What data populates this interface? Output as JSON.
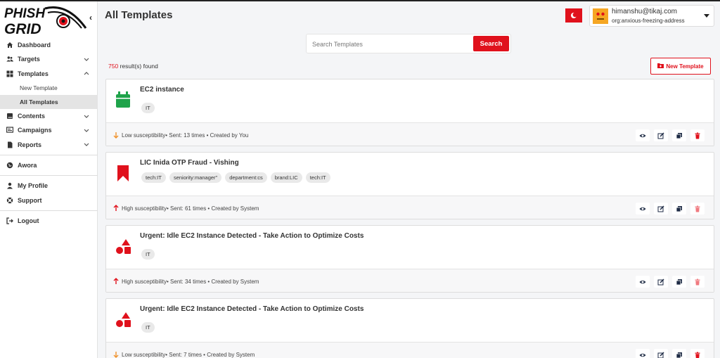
{
  "app": {
    "logo_text": "PHISH GRID",
    "page_title": "All Templates"
  },
  "sidebar": {
    "items": [
      {
        "label": "Dashboard",
        "icon": "home-icon",
        "chevron": false
      },
      {
        "label": "Targets",
        "icon": "users-icon",
        "chevron": "down"
      },
      {
        "label": "Templates",
        "icon": "grid-icon",
        "chevron": "up"
      }
    ],
    "sub_items": [
      {
        "label": "New Template",
        "active": false
      },
      {
        "label": "All Templates",
        "active": true
      }
    ],
    "items2": [
      {
        "label": "Contents",
        "icon": "book-icon",
        "chevron": "down"
      },
      {
        "label": "Campaigns",
        "icon": "campaign-icon",
        "chevron": "down"
      },
      {
        "label": "Reports",
        "icon": "file-icon",
        "chevron": "down"
      }
    ],
    "org": {
      "label": "Awora",
      "icon": "globe-icon"
    },
    "account": [
      {
        "label": "My Profile",
        "icon": "person-icon"
      },
      {
        "label": "Support",
        "icon": "lifebuoy-icon"
      }
    ],
    "logout": {
      "label": "Logout",
      "icon": "logout-icon"
    }
  },
  "header": {
    "user_email": "himanshu@tikaj.com",
    "user_org": "org:anxious-freezing-address",
    "theme_icon": "moon-icon"
  },
  "search": {
    "placeholder": "Search Templates",
    "button": "Search"
  },
  "results": {
    "count": "750",
    "suffix": " result(s) found"
  },
  "new_template_button": "New Template",
  "templates": [
    {
      "title": "EC2 instance",
      "icon": "calendar-icon",
      "tags": [
        "IT"
      ],
      "susceptibility": "Low susceptibility",
      "direction": "down",
      "meta": " • Sent: 13 times • Created by You"
    },
    {
      "title": "LIC Inida OTP Fraud - Vishing",
      "icon": "bookmark-icon",
      "tags": [
        "tech:IT",
        "seniority:manager\"",
        "department:cs",
        "brand:LIC",
        "tech:IT"
      ],
      "susceptibility": "High susceptibility",
      "direction": "up",
      "meta": " • Sent: 61 times • Created by System"
    },
    {
      "title": "Urgent: Idle EC2 Instance Detected - Take Action to Optimize Costs",
      "icon": "shapes-icon",
      "tags": [
        "IT"
      ],
      "susceptibility": "High susceptibility",
      "direction": "up",
      "meta": " • Sent: 34 times • Created by System"
    },
    {
      "title": "Urgent: Idle EC2 Instance Detected - Take Action to Optimize Costs",
      "icon": "shapes-icon",
      "tags": [
        "IT"
      ],
      "susceptibility": "Low susceptibility",
      "direction": "down",
      "meta": " • Sent: 7 times • Created by System"
    }
  ],
  "card_actions": [
    "eye-icon",
    "edit-icon",
    "copy-icon",
    "trash-icon"
  ],
  "colors": {
    "accent": "#e0111c",
    "success": "#1fa34a",
    "low_arrow": "#f0922b"
  }
}
